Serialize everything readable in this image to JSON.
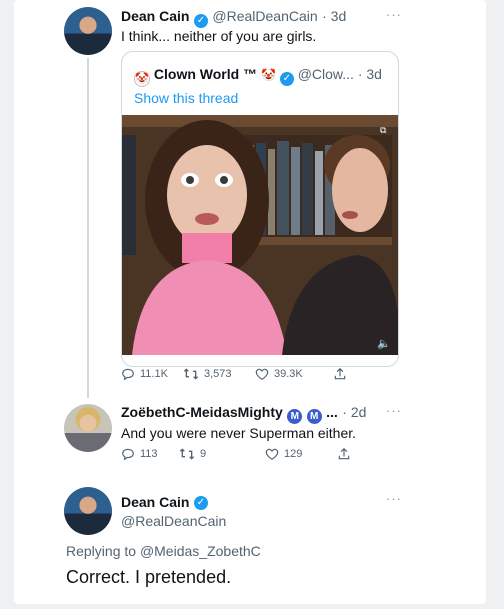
{
  "tweet1": {
    "name": "Dean Cain",
    "handle": "@RealDeanCain",
    "time": "· 3d",
    "text": "I think... neither of you are girls.",
    "more": "···",
    "quote": {
      "name": "Clown World ™",
      "emoji": "🤡",
      "handle": "@Clow...",
      "time": "· 3d",
      "show_thread": "Show this thread"
    },
    "replies": "11.1K",
    "retweets": "3,573",
    "likes": "39.3K"
  },
  "tweet2": {
    "name": "ZoëbethC-MeidasMighty",
    "badges": [
      "M",
      "M"
    ],
    "ellipsis": "...",
    "time": "· 2d",
    "text": "And you were never Superman either.",
    "more": "···",
    "replies": "113",
    "retweets": "9",
    "likes": "129"
  },
  "tweet3": {
    "name": "Dean Cain",
    "handle": "@RealDeanCain",
    "more": "···",
    "replying_to_prefix": "Replying to",
    "replying_to_handle": "@Meidas_ZobethC",
    "text": "Correct. I pretended."
  },
  "icons": {
    "verified": "✓",
    "reply": "reply-icon",
    "retweet": "retweet-icon",
    "like": "heart-icon",
    "share": "share-icon"
  },
  "colors": {
    "accent": "#1d9bf0",
    "muted": "#536471",
    "badge": "#3b5ccf"
  }
}
